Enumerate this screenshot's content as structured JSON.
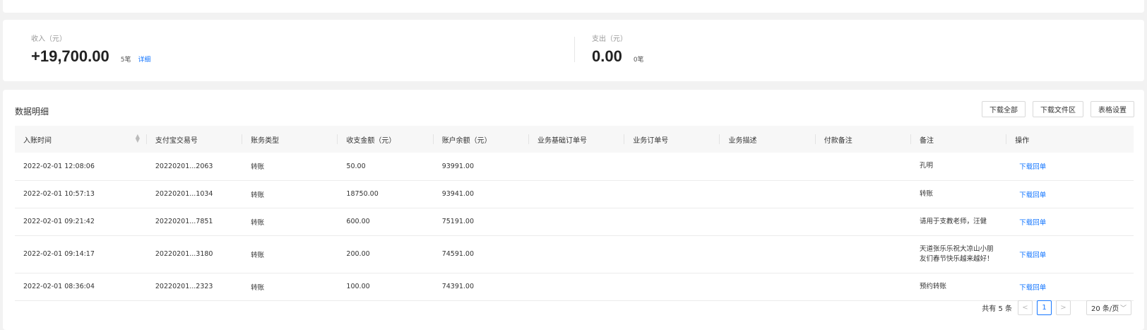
{
  "summary": {
    "income": {
      "label": "收入（元）",
      "amount": "+19,700.00",
      "count": "5笔",
      "link": "详细"
    },
    "expense": {
      "label": "支出（元）",
      "amount": "0.00",
      "count": "0笔"
    }
  },
  "detail": {
    "title": "数据明细",
    "buttons": {
      "download_all": "下载全部",
      "download_files": "下载文件区",
      "table_settings": "表格设置"
    },
    "columns": [
      "入账时间",
      "支付宝交易号",
      "账务类型",
      "收支金额（元）",
      "账户余额（元）",
      "业务基础订单号",
      "业务订单号",
      "业务描述",
      "付款备注",
      "备注",
      "操作"
    ],
    "sort_icon": "sort-icon ⇅",
    "rows": [
      {
        "time": "2022-02-01 12:08:06",
        "trade_no": "20220201...2063",
        "type": "转账",
        "amount": "50.00",
        "balance": "93991.00",
        "base_order": "",
        "order": "",
        "desc": "",
        "pay_remark": "",
        "remark": "孔明",
        "action": "下载回单"
      },
      {
        "time": "2022-02-01 10:57:13",
        "trade_no": "20220201...1034",
        "type": "转账",
        "amount": "18750.00",
        "balance": "93941.00",
        "base_order": "",
        "order": "",
        "desc": "",
        "pay_remark": "",
        "remark": "转账",
        "action": "下载回单"
      },
      {
        "time": "2022-02-01 09:21:42",
        "trade_no": "20220201...7851",
        "type": "转账",
        "amount": "600.00",
        "balance": "75191.00",
        "base_order": "",
        "order": "",
        "desc": "",
        "pay_remark": "",
        "remark": "请用于支教老师，汪健",
        "action": "下载回单"
      },
      {
        "time": "2022-02-01 09:14:17",
        "trade_no": "20220201...3180",
        "type": "转账",
        "amount": "200.00",
        "balance": "74591.00",
        "base_order": "",
        "order": "",
        "desc": "",
        "pay_remark": "",
        "remark": "天道张乐乐祝大凉山小朋友们春节快乐越来越好！",
        "action": "下载回单"
      },
      {
        "time": "2022-02-01 08:36:04",
        "trade_no": "20220201...2323",
        "type": "转账",
        "amount": "100.00",
        "balance": "74391.00",
        "base_order": "",
        "order": "",
        "desc": "",
        "pay_remark": "",
        "remark": "预约转账",
        "action": "下载回单"
      }
    ]
  },
  "pagination": {
    "total": "共有 5 条",
    "prev": "<",
    "current": "1",
    "next": ">",
    "page_size": "20 条/页"
  },
  "colors": {
    "link": "#1677ff",
    "header_bg": "#f7f7f7",
    "page_bg": "#f2f2f2"
  }
}
